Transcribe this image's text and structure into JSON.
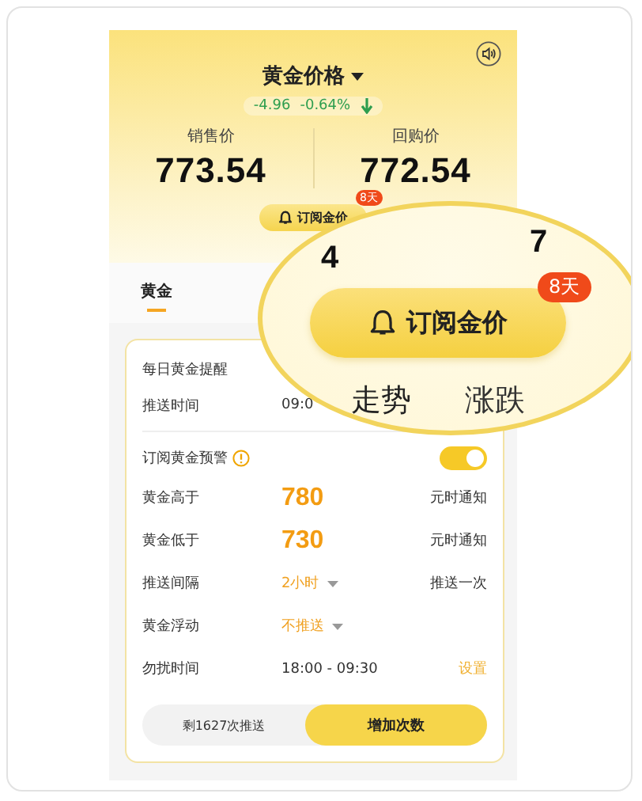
{
  "header": {
    "title": "黄金价格",
    "change": "-4.96",
    "change_pct": "-0.64%",
    "prices": [
      {
        "label": "销售价",
        "value": "773.54"
      },
      {
        "label": "回购价",
        "value": "772.54"
      }
    ],
    "subscribe": {
      "label": "订阅金价",
      "badge": "8天"
    }
  },
  "tabs": [
    {
      "label": "黄金",
      "selected": true
    }
  ],
  "daily": {
    "title": "每日黄金提醒",
    "rows": [
      {
        "label": "推送时间",
        "value": "09:0"
      }
    ]
  },
  "alert": {
    "label": "订阅黄金预警",
    "on": true,
    "rows": [
      {
        "kind": "threshold",
        "label": "黄金高于",
        "value": "780",
        "note": "元时通知"
      },
      {
        "kind": "threshold",
        "label": "黄金低于",
        "value": "730",
        "note": "元时通知"
      },
      {
        "kind": "select",
        "label": "推送间隔",
        "value": "2小时",
        "note": "推送一次"
      },
      {
        "kind": "select",
        "label": "黄金浮动",
        "value": "不推送"
      },
      {
        "kind": "range",
        "label": "勿扰时间",
        "value": "18:00 - 09:30",
        "note": "设置"
      }
    ]
  },
  "footer": {
    "remaining": "剩1627次推送",
    "button": "增加次数"
  },
  "magnifier": {
    "digits": [
      "4",
      "7"
    ],
    "subscribe": {
      "label": "订阅金价",
      "badge": "8天"
    },
    "texts": [
      "走势",
      "涨跌"
    ]
  }
}
